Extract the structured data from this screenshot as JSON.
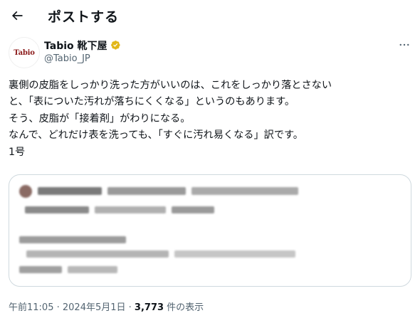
{
  "header": {
    "back_icon": "arrow-left-icon",
    "title": "ポストする"
  },
  "author": {
    "avatar_text": "Tabio",
    "display_name": "Tabio 靴下屋",
    "verified_icon": "verified-badge-icon",
    "verified_color": "#e2b719",
    "handle": "@Tabio_JP",
    "more_icon": "more-horizontal-icon",
    "brand_color": "#8b1a1a"
  },
  "tweet": {
    "lines": [
      "裏側の皮脂をしっかり洗った方がいいのは、これをしっかり落とさない",
      "と、「表についた汚れが落ちにくくなる」というのもあります。",
      "そう、皮脂が「接着剤」がわりになる。",
      "なんで、どれだけ表を洗っても、「すぐに汚れ易くなる」訳です。",
      "1号"
    ]
  },
  "quote": {
    "state": "blurred"
  },
  "meta": {
    "time": "午前11:05",
    "sep1": " · ",
    "date": "2024年5月1日",
    "sep2": " · ",
    "views": "3,773",
    "views_suffix": " 件の表示"
  }
}
